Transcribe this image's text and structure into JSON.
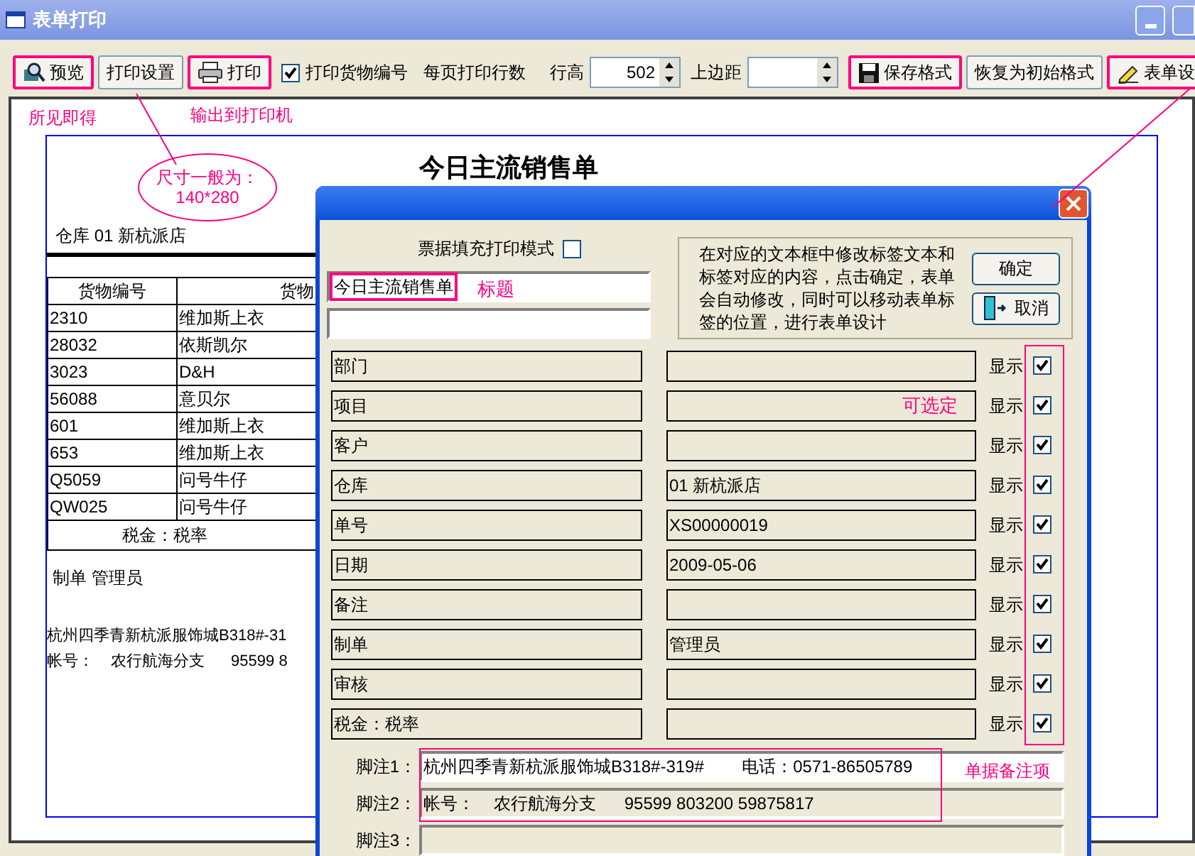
{
  "window": {
    "title": "表单打印"
  },
  "toolbar": [
    {
      "kind": "preview",
      "label": "预览",
      "annotated": true
    },
    {
      "kind": "button",
      "label": "打印设置",
      "annotated": false
    },
    {
      "kind": "print",
      "label": "打印",
      "annotated": true
    },
    {
      "kind": "checkbox",
      "label": "打印货物编号",
      "checked": true
    },
    {
      "kind": "text",
      "label": "每页打印行数"
    },
    {
      "kind": "spin",
      "label": "行高",
      "value": "502"
    },
    {
      "kind": "spin",
      "label": "上边距"
    },
    {
      "kind": "save",
      "label": "保存格式",
      "annotated": true
    },
    {
      "kind": "button",
      "label": "恢复为初始格式",
      "annotated": false
    },
    {
      "kind": "design",
      "label": "表单设",
      "annotated": true
    }
  ],
  "notes": {
    "wysiwyg": "所见即得",
    "printer": "输出到打印机",
    "size": [
      "尺寸一般为：",
      "140*280"
    ]
  },
  "preview": {
    "title": "今日主流销售单",
    "warehouse": "仓库 01 新杭派店",
    "table": {
      "columns": [
        "货物编号",
        "货物"
      ],
      "rows": [
        [
          "2310",
          "维加斯上衣"
        ],
        [
          "28032",
          "依斯凯尔"
        ],
        [
          "3023",
          "D&H"
        ],
        [
          "56088",
          "意贝尔"
        ],
        [
          "601",
          "维加斯上衣"
        ],
        [
          "653",
          "维加斯上衣"
        ],
        [
          "Q5059",
          "问号牛仔"
        ],
        [
          "QW025",
          "问号牛仔"
        ]
      ],
      "tax_row": "税金：税率"
    },
    "maker": "制单 管理员",
    "footers": [
      "杭州四季青新杭派服饰城B318#-31",
      "帐号：    农行航海分支      95599 8"
    ]
  },
  "dialog": {
    "fill_mode": {
      "label": "票据填充打印模式",
      "checked": false
    },
    "title_field": {
      "value": "今日主流销售单",
      "note": "标题"
    },
    "info": "在对应的文本框中修改标签文本和标签对应的内容，点击确定，表单会自动修改，同时可以移动表单标签的位置，进行表单设计",
    "buttons": [
      {
        "kind": "ok",
        "label": "确定"
      },
      {
        "kind": "cancel",
        "label": "取消"
      }
    ],
    "fields": [
      {
        "label": "部门",
        "show": "显示",
        "checked": true
      },
      {
        "label": "项目",
        "show": "显示",
        "checked": true
      },
      {
        "label": "客户",
        "show": "显示",
        "checked": true
      },
      {
        "label": "仓库",
        "value": "01 新杭派店",
        "show": "显示",
        "checked": true
      },
      {
        "label": "单号",
        "value": "XS00000019",
        "show": "显示",
        "checked": true
      },
      {
        "label": "日期",
        "value": "2009-05-06",
        "show": "显示",
        "checked": true
      },
      {
        "label": "备注",
        "show": "显示",
        "checked": true
      },
      {
        "label": "制单",
        "value": "管理员",
        "show": "显示",
        "checked": true
      },
      {
        "label": "审核",
        "show": "显示",
        "checked": true
      },
      {
        "label": "税金：税率",
        "show": "显示",
        "checked": true
      }
    ],
    "optional_note": "可选定",
    "footnotes": [
      {
        "label": "脚注1：",
        "value": "杭州四季青新杭派服饰城B318#-319#        电话：0571-86505789",
        "focused": true
      },
      {
        "label": "脚注2：",
        "value": "帐号：    农行航海分支      95599 803200 59875817",
        "focused": false
      },
      {
        "label": "脚注3：",
        "focused": false
      }
    ],
    "footnote_note": "单据备注项"
  }
}
